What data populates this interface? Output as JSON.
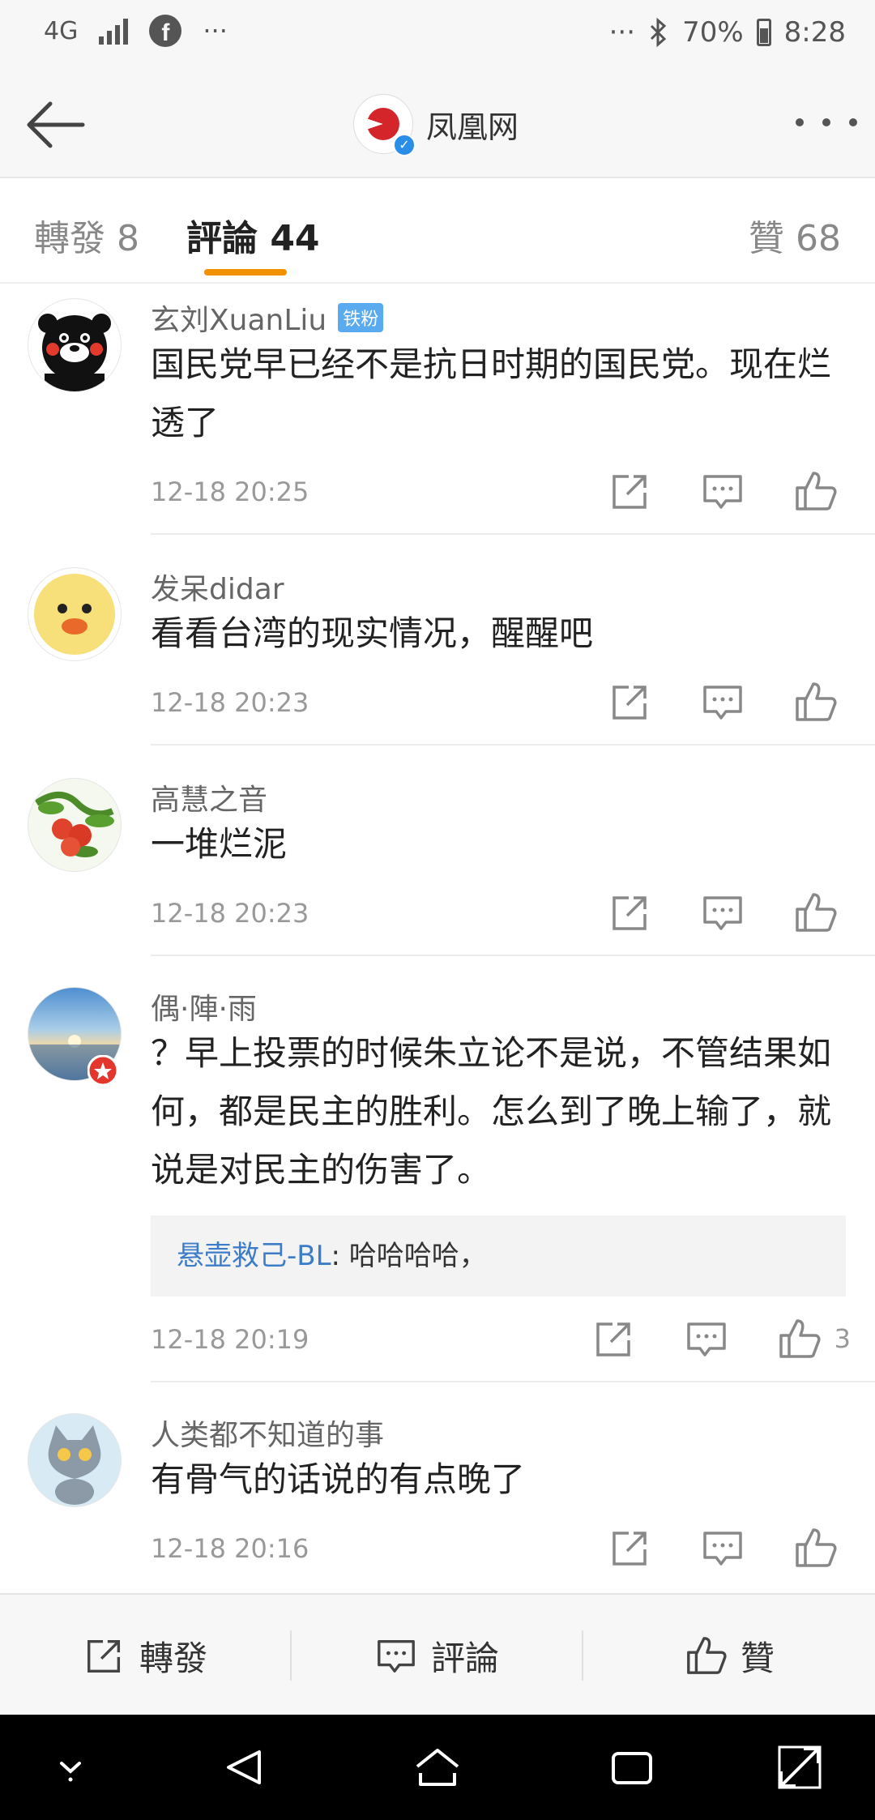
{
  "status_bar": {
    "left_icons": [
      "4g-icon",
      "signal-icon",
      "facebook-icon",
      "more-notifications-icon"
    ],
    "network": "4G",
    "ellipsis_left": "···",
    "ellipsis_right": "···",
    "battery": "70%",
    "time": "8:28"
  },
  "nav": {
    "title": "凤凰网",
    "logo_name": "凤凰网 logo",
    "verified": true
  },
  "tabs": [
    {
      "label": "轉發 8",
      "active": false
    },
    {
      "label": "評論 44",
      "active": true
    },
    {
      "label": "贊 68",
      "active": false
    }
  ],
  "comments": [
    {
      "user": "玄刘XuanLiu",
      "badge": "铁粉",
      "text": "国民党早已经不是抗日时期的国民党。现在烂透了",
      "time": "12-18 20:25",
      "likes": ""
    },
    {
      "user": "发呆didar",
      "badge": "",
      "text": "看看台湾的现实情况，醒醒吧",
      "time": "12-18 20:23",
      "likes": ""
    },
    {
      "user": "高慧之音",
      "badge": "",
      "text": "一堆烂泥",
      "time": "12-18 20:23",
      "likes": ""
    },
    {
      "user": "偶·陣·雨",
      "badge": "",
      "text": "？早上投票的时候朱立论不是说，不管结果如何，都是民主的胜利。怎么到了晚上输了，就说是对民主的伤害了。",
      "reply_user": "悬壶救己-BL",
      "reply_text": ": 哈哈哈哈，",
      "time": "12-18 20:19",
      "likes": "3"
    },
    {
      "user": "人类都不知道的事",
      "badge": "",
      "text": "有骨气的话说的有点晚了",
      "time": "12-18 20:16",
      "likes": ""
    }
  ],
  "bottom_bar": {
    "repost": "轉發",
    "comment": "評論",
    "like": "贊"
  },
  "colors": {
    "accent": "#f29100",
    "link": "#3d7cc8",
    "badge": "#5aaaf0",
    "brand_red": "#d4262a"
  }
}
